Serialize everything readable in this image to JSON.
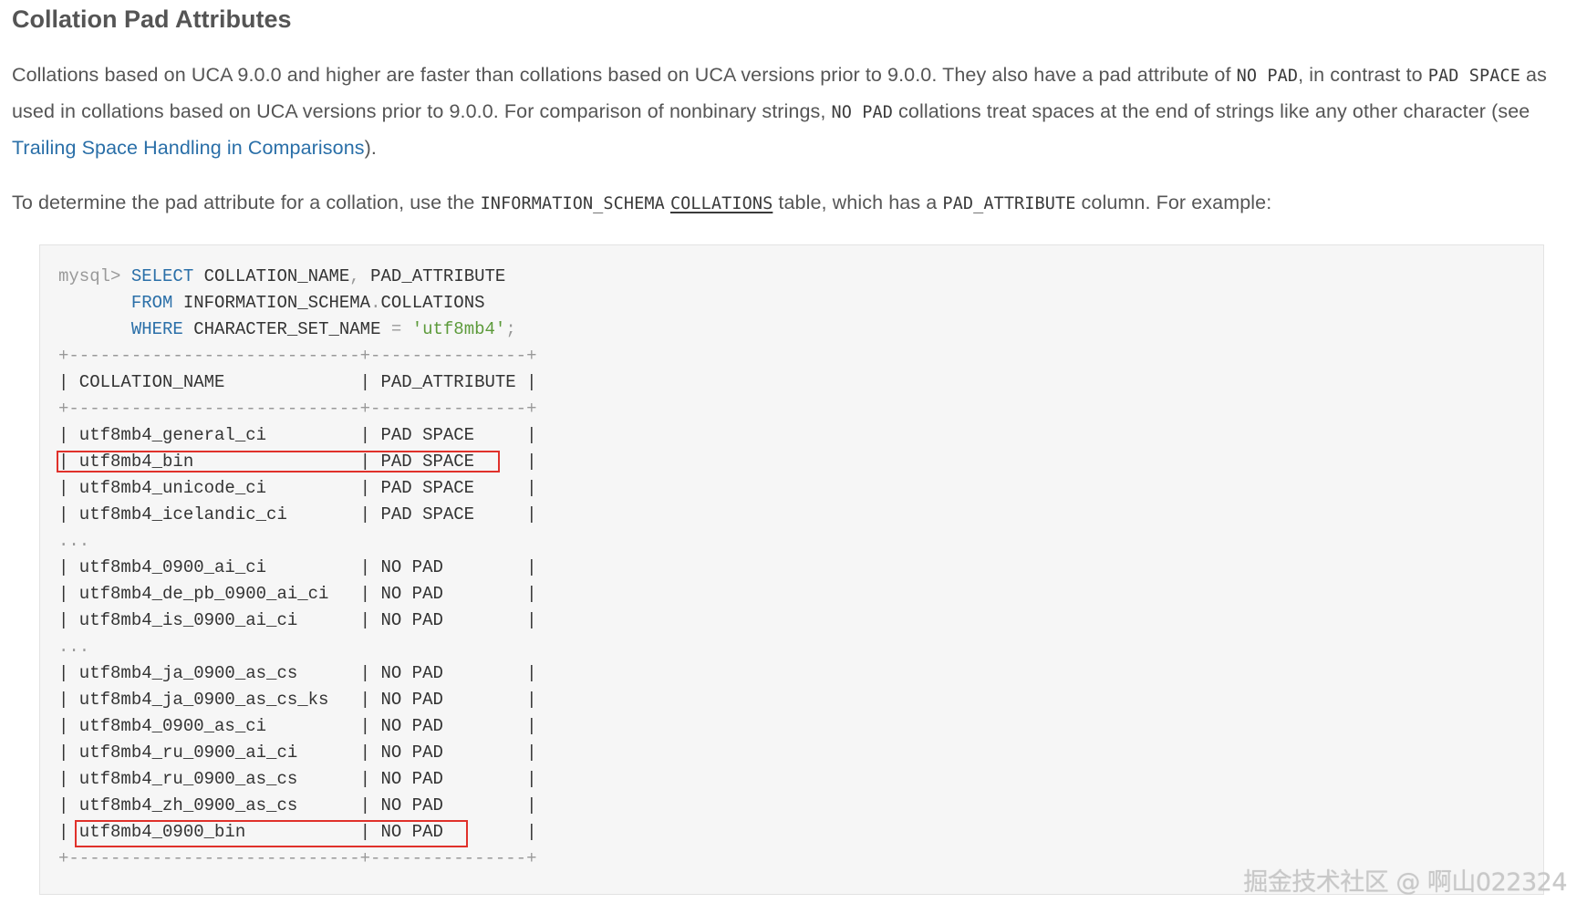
{
  "heading": "Collation Pad Attributes",
  "paragraph1": {
    "t1": "Collations based on UCA 9.0.0 and higher are faster than collations based on UCA versions prior to 9.0.0. They also have a pad attribute of ",
    "c1": "NO PAD",
    "t2": ", in contrast to ",
    "c2": "PAD SPACE",
    "t3": " as used in collations based on UCA versions prior to 9.0.0. For comparison of nonbinary strings, ",
    "c3": "NO PAD",
    "t4": " collations treat spaces at the end of strings like any other character (see ",
    "link": "Trailing Space Handling in Comparisons",
    "t5": ")."
  },
  "paragraph2": {
    "t1": "To determine the pad attribute for a collation, use the ",
    "c1": "INFORMATION_SCHEMA",
    "c2": "COLLATIONS",
    "t2": " table, which has a ",
    "c3": "PAD_ATTRIBUTE",
    "t3": " column. For example:"
  },
  "code": {
    "prompt": "mysql>",
    "query": {
      "select_kw": "SELECT",
      "select_cols_a": "COLLATION_NAME",
      "select_cols_b": "PAD_ATTRIBUTE",
      "from_kw": "FROM",
      "from_schema": "INFORMATION_SCHEMA",
      "from_table": "COLLATIONS",
      "where_kw": "WHERE",
      "where_col": "CHARACTER_SET_NAME",
      "where_op": "=",
      "where_val": "'utf8mb4'"
    },
    "separator": "+----------------------------+---------------+",
    "header": "| COLLATION_NAME             | PAD_ATTRIBUTE |",
    "rows": [
      "| utf8mb4_general_ci         | PAD SPACE     |",
      "| utf8mb4_bin                | PAD SPACE     |",
      "| utf8mb4_unicode_ci         | PAD SPACE     |",
      "| utf8mb4_icelandic_ci       | PAD SPACE     |",
      "...",
      "| utf8mb4_0900_ai_ci         | NO PAD        |",
      "| utf8mb4_de_pb_0900_ai_ci   | NO PAD        |",
      "| utf8mb4_is_0900_ai_ci      | NO PAD        |",
      "...",
      "| utf8mb4_ja_0900_as_cs      | NO PAD        |",
      "| utf8mb4_ja_0900_as_cs_ks   | NO PAD        |",
      "| utf8mb4_0900_as_ci         | NO PAD        |",
      "| utf8mb4_ru_0900_ai_ci      | NO PAD        |",
      "| utf8mb4_ru_0900_as_cs      | NO PAD        |",
      "| utf8mb4_zh_0900_as_cs      | NO PAD        |",
      "| utf8mb4_0900_bin           | NO PAD        |"
    ]
  },
  "watermark": "掘金技术社区 @ 啊山022324",
  "colors": {
    "highlight_box": "#e0312b",
    "keyword": "#2a6fa8",
    "string": "#5c9a3a",
    "link": "#2a6fa8"
  }
}
